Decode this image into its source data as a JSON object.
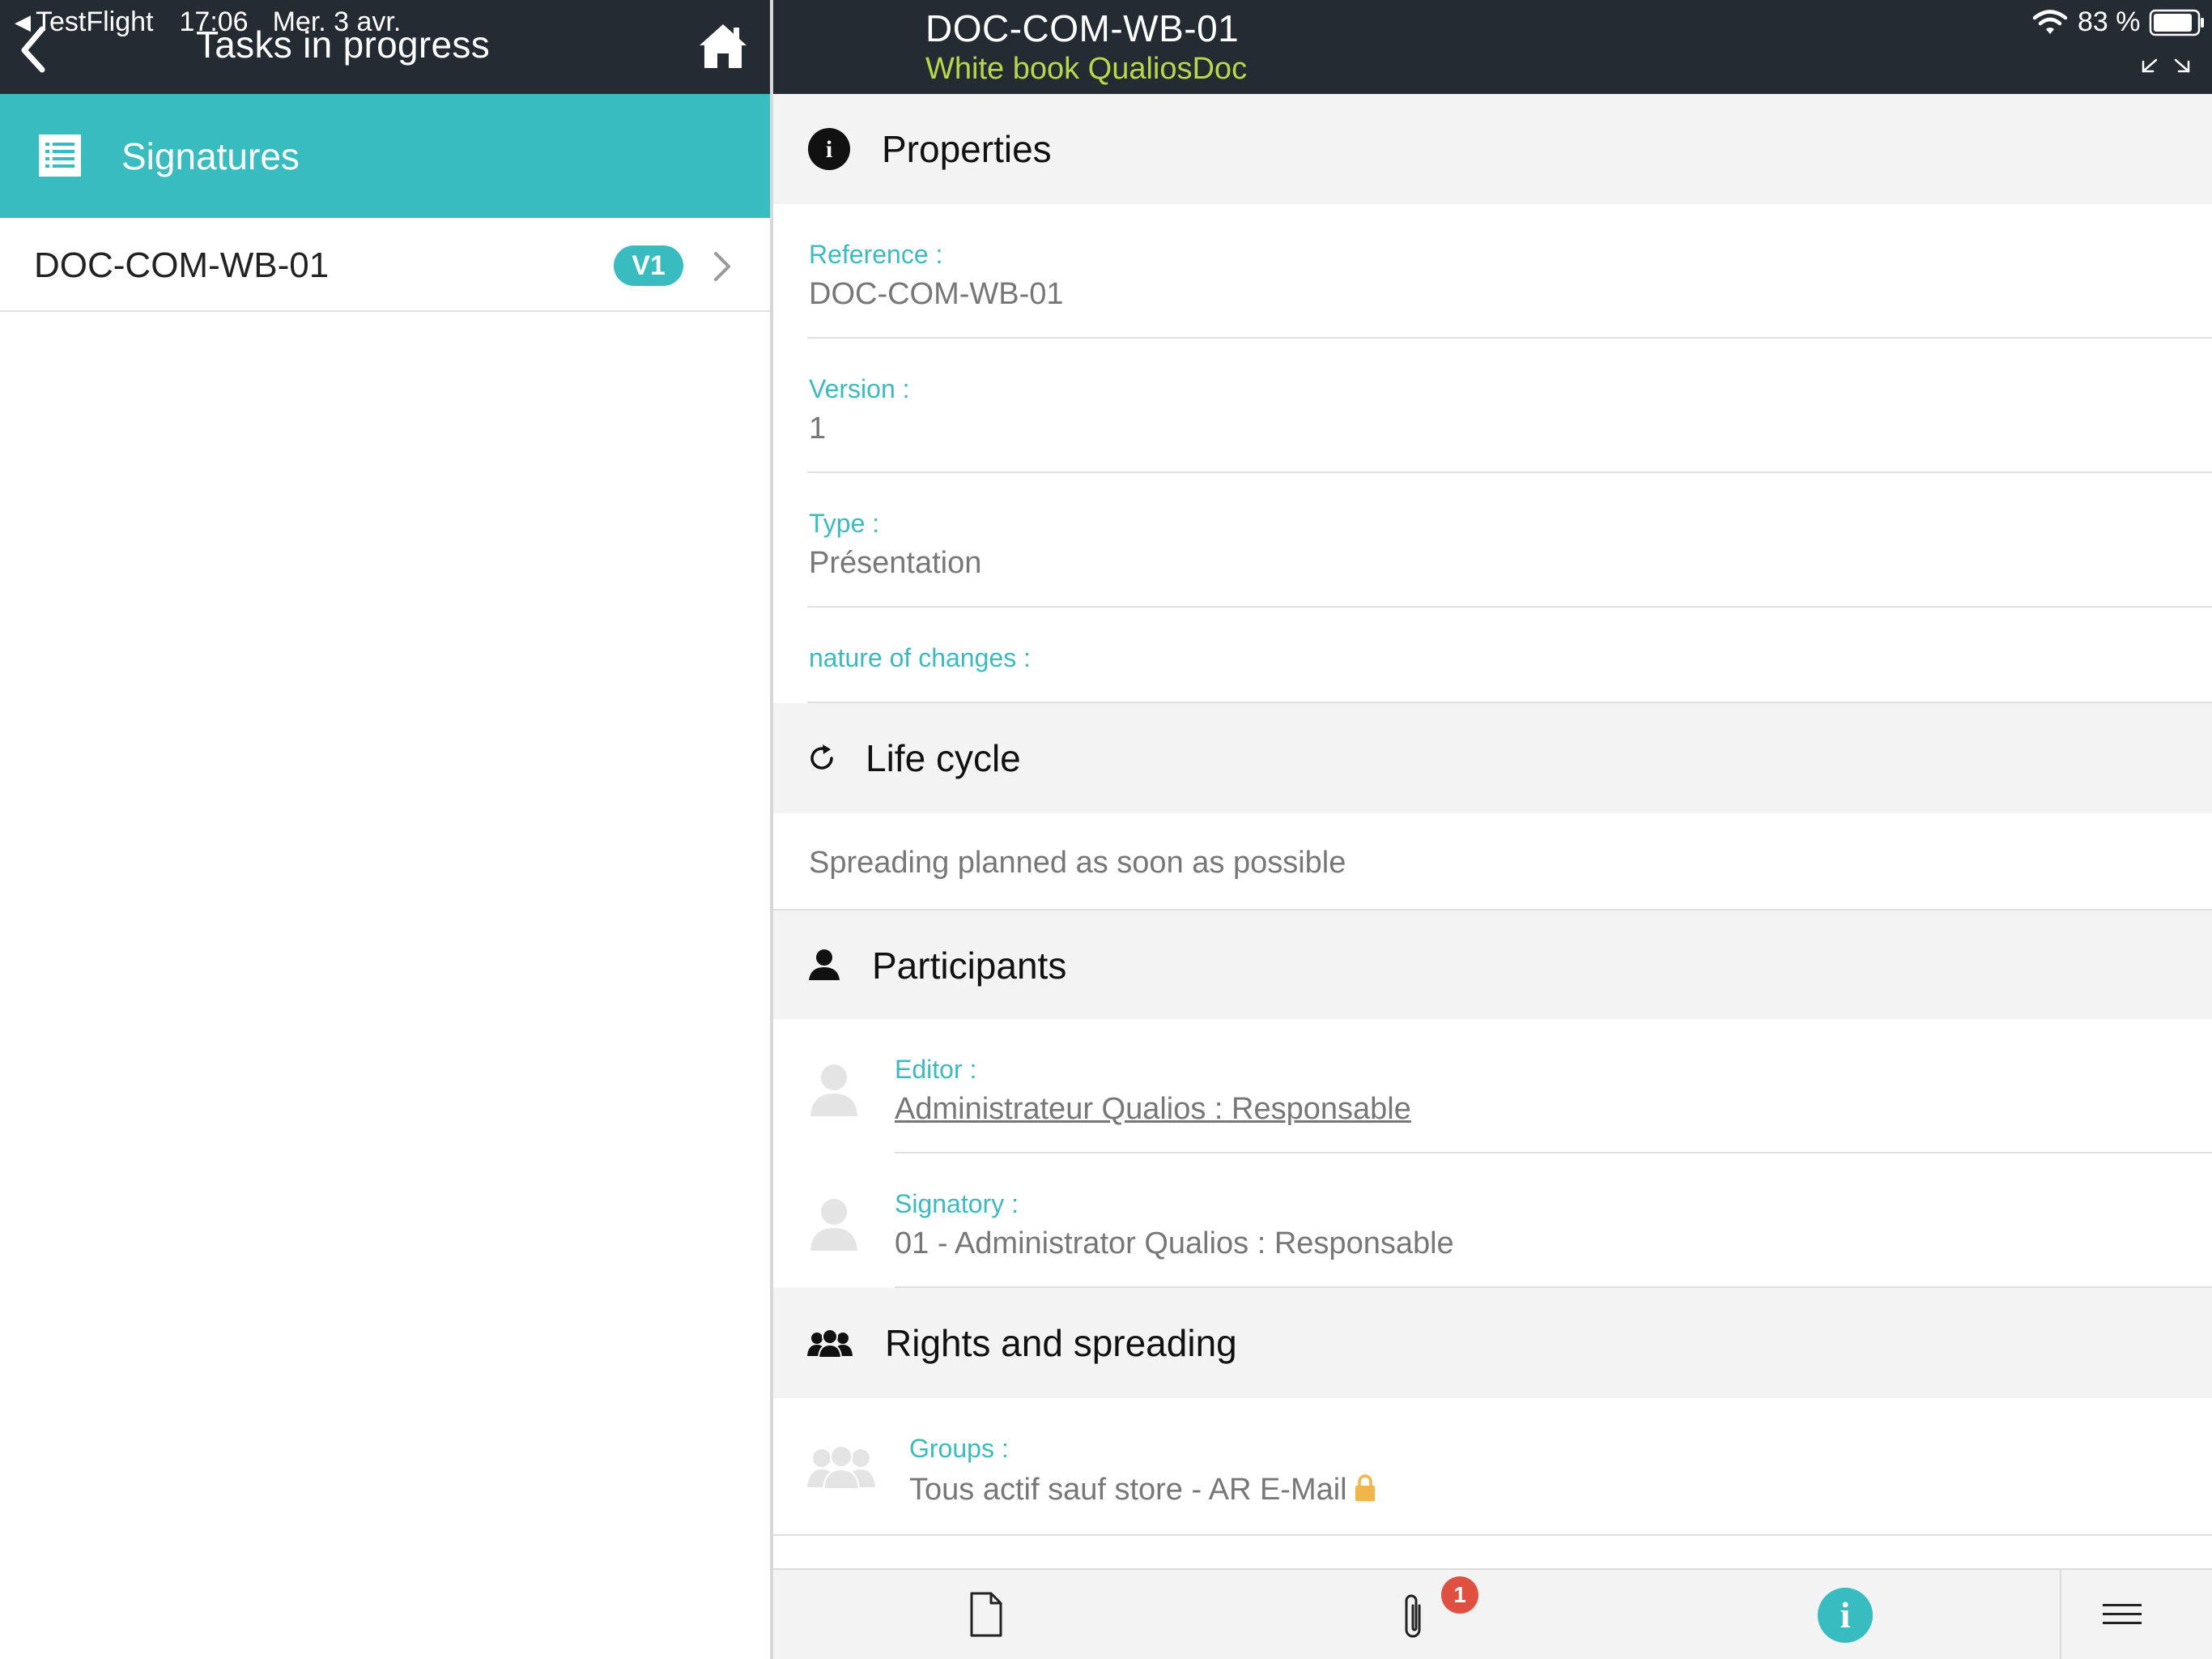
{
  "status_bar": {
    "back_app": "TestFlight",
    "time": "17:06",
    "date": "Mer. 3 avr.",
    "battery": "83 %"
  },
  "left_pane": {
    "title": "Tasks in progress",
    "section_label": "Signatures",
    "list": [
      {
        "label": "DOC-COM-WB-01",
        "badge": "V1"
      }
    ]
  },
  "right_pane": {
    "doc_title": "DOC-COM-WB-01",
    "doc_subtitle": "White book QualiosDoc",
    "properties": {
      "title": "Properties",
      "info_glyph": "i",
      "fields": [
        {
          "label": "Reference :",
          "value": "DOC-COM-WB-01"
        },
        {
          "label": "Version :",
          "value": "1"
        },
        {
          "label": "Type :",
          "value": "Présentation"
        },
        {
          "label": "nature of changes :",
          "value": ""
        }
      ]
    },
    "life_cycle": {
      "title": "Life cycle",
      "text": "Spreading planned as soon as possible"
    },
    "participants": {
      "title": "Participants",
      "items": [
        {
          "label": "Editor :",
          "value": "Administrateur Qualios : Responsable"
        },
        {
          "label": "Signatory :",
          "value": "01 - Administrator Qualios : Responsable"
        }
      ]
    },
    "rights": {
      "title": "Rights and spreading",
      "items": [
        {
          "label": "Groups :",
          "value": "Tous actif sauf store - AR E-Mail"
        }
      ]
    }
  },
  "toolbar": {
    "attachment_count": "1",
    "info_glyph": "i"
  },
  "colors": {
    "header_bg": "#252b33",
    "accent": "#38bcc0",
    "subtitle": "#b6d94c",
    "badge_red": "#e05040",
    "section_bg": "#f3f3f3"
  },
  "icons": [
    "back-chevron-icon",
    "home-icon",
    "list-icon",
    "chevron-right-icon",
    "wifi-icon",
    "battery-icon",
    "expand-icon",
    "info-icon",
    "refresh-icon",
    "person-icon",
    "group-icon",
    "avatar-icon",
    "lock-icon",
    "document-icon",
    "paperclip-icon",
    "menu-icon"
  ]
}
